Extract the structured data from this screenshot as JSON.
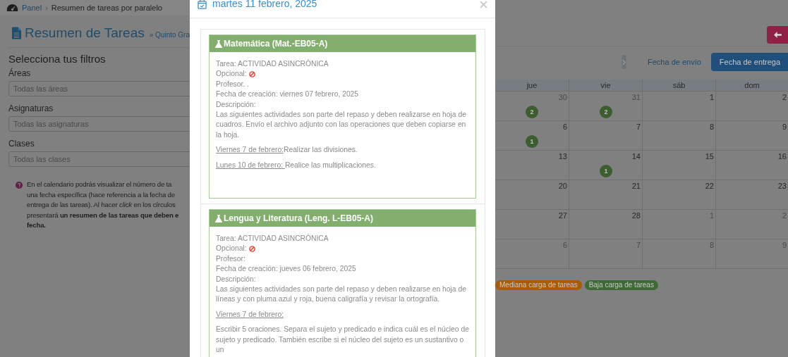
{
  "breadcrumb_separator": "›",
  "breadcrumb": [
    {
      "label": "Panel",
      "link": true
    },
    {
      "label": "Resumen de tareas por paralelo",
      "link": false
    }
  ],
  "page_header": {
    "title": "Resumen de Tareas",
    "subtitle": "» Quinto Gra"
  },
  "filters": {
    "heading": "Selecciona tus filtros",
    "fields": [
      {
        "label": "Áreas",
        "placeholder": "Todas las áreas"
      },
      {
        "label": "Asignaturas",
        "placeholder": "Todas las asignaturas"
      },
      {
        "label": "Clases",
        "placeholder": "Todas las clases"
      }
    ]
  },
  "help_text": "En el calendario podrás visualizar el número de ta\nuna fecha específica (hace referencia a la fecha de\nentrega de las tareas). Al hacer *click* en los círculos\npresentará **un resumen de las tareas que deben e**\n**fecha.**",
  "calendar": {
    "date_modes": [
      {
        "label": "Fecha de envío",
        "selected": false
      },
      {
        "label": "Fecha de entrega",
        "selected": true
      }
    ],
    "weekdays": [
      "jue",
      "vie",
      "sáb",
      "dom"
    ],
    "weeks": [
      [
        {
          "day": "30",
          "muted": true,
          "count": "2"
        },
        {
          "day": "31",
          "muted": true,
          "count": "2"
        },
        {
          "day": "1",
          "muted": false
        },
        {
          "day": "2",
          "muted": false
        }
      ],
      [
        {
          "day": "6",
          "muted": false,
          "count": "1"
        },
        {
          "day": "7",
          "muted": false
        },
        {
          "day": "8",
          "muted": false
        },
        {
          "day": "9",
          "muted": false
        }
      ],
      [
        {
          "day": "13",
          "muted": false
        },
        {
          "day": "14",
          "muted": false,
          "count": "1"
        },
        {
          "day": "15",
          "muted": false
        },
        {
          "day": "16",
          "muted": false
        }
      ],
      [
        {
          "day": "20",
          "muted": false
        },
        {
          "day": "21",
          "muted": false
        },
        {
          "day": "22",
          "muted": false
        },
        {
          "day": "23",
          "muted": false
        }
      ],
      [
        {
          "day": "27",
          "muted": false
        },
        {
          "day": "28",
          "muted": false
        },
        {
          "day": "1",
          "muted": true
        },
        {
          "day": "2",
          "muted": true
        }
      ],
      [
        {
          "day": "6",
          "muted": true
        },
        {
          "day": "7",
          "muted": true
        },
        {
          "day": "8",
          "muted": true
        },
        {
          "day": "9",
          "muted": true
        }
      ]
    ],
    "legend": [
      {
        "label": "Mediana carga de tareas",
        "color": "#a85c06"
      },
      {
        "label": "Baja carga de tareas",
        "color": "#3f6a35"
      }
    ]
  },
  "modal": {
    "title": "martes 11 febrero, 2025",
    "tasks": [
      {
        "subject": "Matemática (Mat.-EB05-A)",
        "tarea": "Tarea: ACTIVIDAD ASINCRÓNICA",
        "optional_label": "Opcional:",
        "optional": false,
        "profesor": "Profesor. .",
        "created": "Fecha de creación: viernes 07 febrero, 2025",
        "description_label": "Descripción:",
        "description": "Las siguientes actividades son parte del repaso y deben realizarse  en hoja de cuadros. Envío el archivo adjunto con las operaciones que deben copiarse en la hoja.",
        "entries": [
          {
            "date": "Viernes 7 de febrero:",
            "text": "Realizar las divisiones."
          },
          {
            "date": "Lunes 10 de febrero: ",
            "text": "Realice las multiplicaciones."
          }
        ]
      },
      {
        "subject": "Lengua y Literatura (Leng. L-EB05-A)",
        "tarea": "Tarea: ACTIVIDAD ASINCRÓNICA",
        "optional_label": "Opcional:",
        "optional": false,
        "profesor": "Profesor:",
        "created": "Fecha de creación: jueves 06 febrero, 2025",
        "description_label": "Descripción:",
        "description": "Las siguientes actividades son parte del repaso y deben realizarse  en hoja de líneas y con pluma azul y roja, buena caligrafía y revisar la ortografía.",
        "entries": [
          {
            "date": "Viernes 7 de febrero:",
            "text": "Escribir 5 oraciones. Separa el sujeto y predicado e indica cuál es el núcleo de sujeto y predicado. También escribe si el núcleo del sujeto es un sustantivo o un"
          }
        ]
      }
    ]
  }
}
